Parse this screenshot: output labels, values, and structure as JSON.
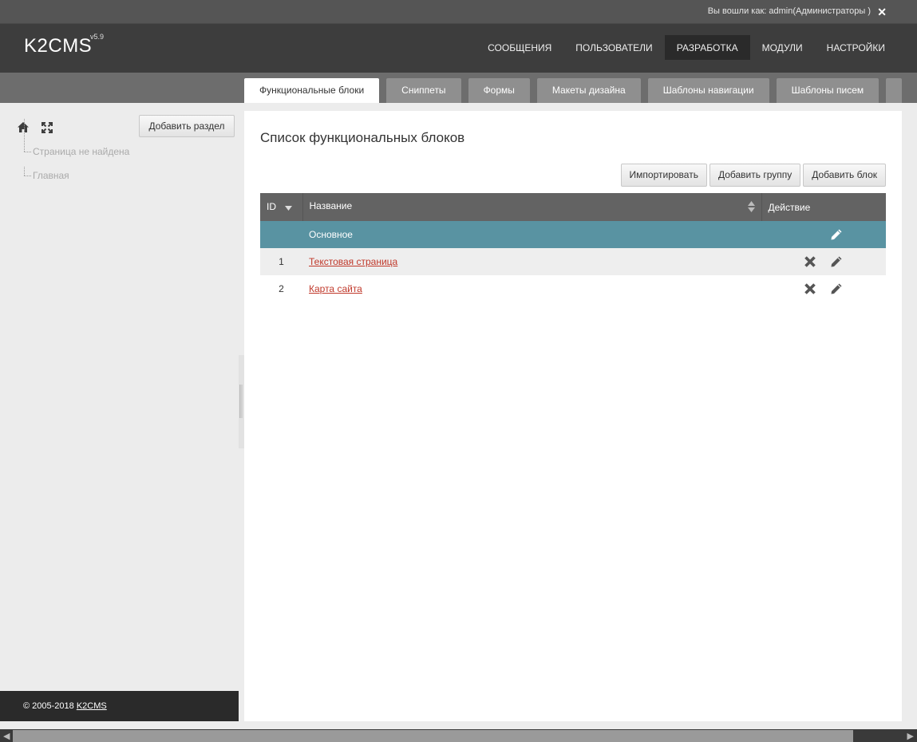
{
  "topbar": {
    "login_text": "Вы вошли как: admin(Администраторы )",
    "logout_icon": "close-icon"
  },
  "header": {
    "logo": "K2CMS",
    "version": "v5.9"
  },
  "mainnav": [
    {
      "label": "СООБЩЕНИЯ",
      "active": false
    },
    {
      "label": "ПОЛЬЗОВАТЕЛИ",
      "active": false
    },
    {
      "label": "РАЗРАБОТКА",
      "active": true
    },
    {
      "label": "МОДУЛИ",
      "active": false
    },
    {
      "label": "НАСТРОЙКИ",
      "active": false
    }
  ],
  "tabs": [
    {
      "label": "Функциональные блоки",
      "active": true
    },
    {
      "label": "Сниппеты",
      "active": false
    },
    {
      "label": "Формы",
      "active": false
    },
    {
      "label": "Макеты дизайна",
      "active": false
    },
    {
      "label": "Шаблоны навигации",
      "active": false
    },
    {
      "label": "Шаблоны писем",
      "active": false
    }
  ],
  "sidebar": {
    "add_section_label": "Добавить раздел",
    "icons": [
      "home-icon",
      "expand-icon"
    ],
    "tree": [
      "Страница не найдена",
      "Главная"
    ]
  },
  "footer": {
    "copyright": "© 2005-2018 ",
    "link": "K2CMS"
  },
  "main": {
    "title": "Список функциональных блоков",
    "buttons": {
      "import": "Импортировать",
      "add_group": "Добавить группу",
      "add_block": "Добавить блок"
    },
    "table": {
      "headers": {
        "id": "ID",
        "name": "Название",
        "action": "Действие"
      },
      "group": {
        "name": "Основное"
      },
      "rows": [
        {
          "id": "1",
          "name": "Текстовая страница"
        },
        {
          "id": "2",
          "name": "Карта сайта"
        }
      ]
    }
  },
  "colors": {
    "group_row": "#5993a2",
    "link": "#c0392b",
    "header_bg": "#3d3d3d"
  }
}
